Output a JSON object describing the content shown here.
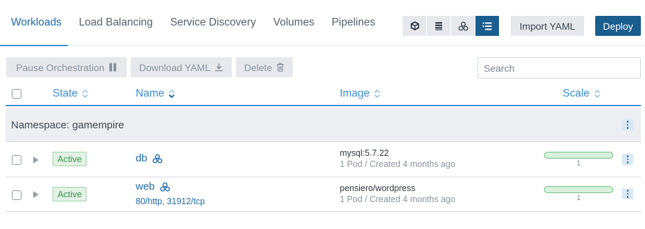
{
  "nav": {
    "tabs": [
      {
        "label": "Workloads",
        "active": true
      },
      {
        "label": "Load Balancing",
        "active": false
      },
      {
        "label": "Service Discovery",
        "active": false
      },
      {
        "label": "Volumes",
        "active": false
      },
      {
        "label": "Pipelines",
        "active": false
      }
    ],
    "view_modes": [
      "cube-icon",
      "list-flat-icon",
      "group-icon",
      "list-grouped-icon"
    ],
    "active_view": "list-grouped-icon",
    "import_label": "Import YAML",
    "deploy_label": "Deploy"
  },
  "bulk_actions": {
    "pause": "Pause Orchestration",
    "download": "Download YAML",
    "delete": "Delete"
  },
  "search": {
    "placeholder": "Search"
  },
  "columns": {
    "state": "State",
    "name": "Name",
    "image": "Image",
    "scale": "Scale"
  },
  "group": {
    "label": "Namespace: gamempire"
  },
  "rows": [
    {
      "state": "Active",
      "name": "db",
      "endpoint": "",
      "image": "mysql:5.7.22",
      "meta": "1 Pod / Created 4 months ago",
      "scale": "1"
    },
    {
      "state": "Active",
      "name": "web",
      "endpoint": "80/http, 31912/tcp",
      "image": "pensiero/wordpress",
      "meta": "1 Pod / Created 4 months ago",
      "scale": "1"
    }
  ],
  "colors": {
    "accent": "#3b8fd3",
    "primary": "#1a5d8f",
    "active_badge": "#3e8f4e"
  }
}
